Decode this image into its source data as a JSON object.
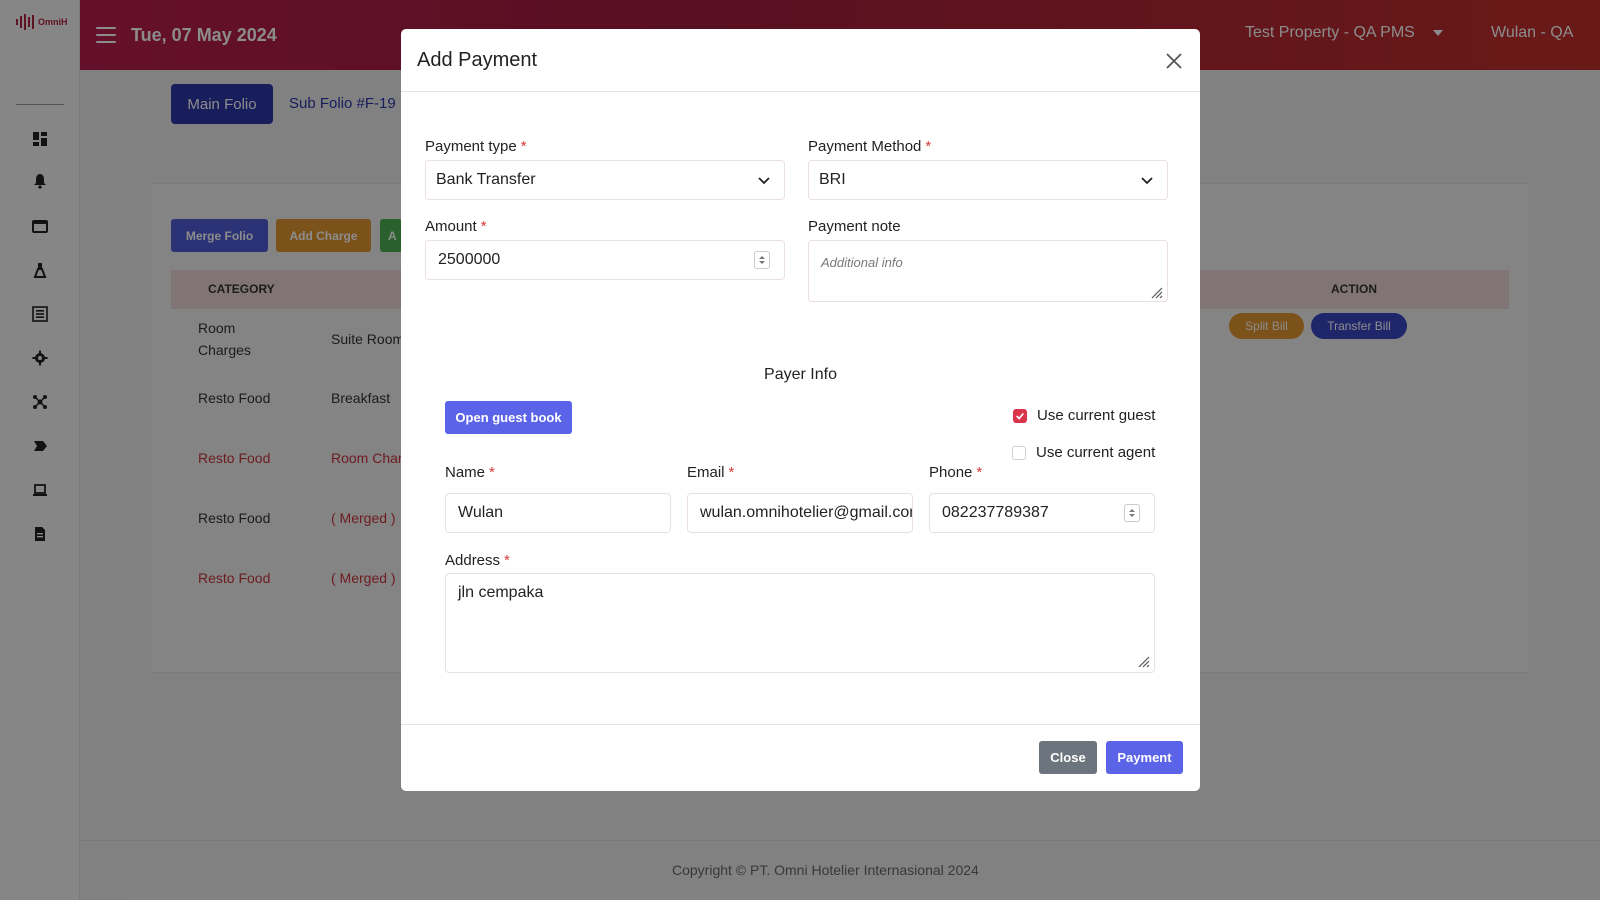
{
  "sidebar": {
    "logo_text": "OmniH",
    "icons": [
      "dashboard-icon",
      "bell-icon",
      "folder-icon",
      "flask-icon",
      "list-icon",
      "gear-icon",
      "network-icon",
      "tag-icon",
      "laptop-icon",
      "document-icon"
    ]
  },
  "header": {
    "date": "Tue, 07 May 2024",
    "property": "Test Property - QA PMS",
    "user": "Wulan - QA"
  },
  "folio": {
    "main_label": "Main Folio",
    "sub_label": "Sub Folio #F-19"
  },
  "actions": {
    "merge": "Merge Folio",
    "add_charge": "Add Charge",
    "third": "A"
  },
  "table": {
    "headers": {
      "category": "CATEGORY",
      "action": "ACTION"
    },
    "rows": [
      {
        "category": "Room\nCharges",
        "item": "Suite Room",
        "red": false
      },
      {
        "category": "Resto Food",
        "item": "Breakfast",
        "red": false
      },
      {
        "category": "Resto Food",
        "item": "Room Char",
        "red": true
      },
      {
        "category": "Resto Food",
        "item": "( Merged )",
        "red": false
      },
      {
        "category": "Resto Food",
        "item": "( Merged )",
        "red": true
      }
    ],
    "split_bill": "Split Bill",
    "transfer_bill": "Transfer Bill"
  },
  "footer": {
    "copyright": "Copyright © PT. Omni Hotelier Internasional 2024"
  },
  "modal": {
    "title": "Add Payment",
    "payment_type_label": "Payment type",
    "payment_type_value": "Bank Transfer",
    "payment_method_label": "Payment Method",
    "payment_method_value": "BRI",
    "amount_label": "Amount",
    "amount_value": "2500000",
    "note_label": "Payment note",
    "note_placeholder": "Additional info",
    "payer_info_title": "Payer Info",
    "open_guest_book": "Open guest book",
    "use_current_guest": "Use current guest",
    "use_current_guest_checked": true,
    "use_current_agent": "Use current agent",
    "use_current_agent_checked": false,
    "name_label": "Name",
    "name_value": "Wulan",
    "email_label": "Email",
    "email_value": "wulan.omnihotelier@gmail.com",
    "phone_label": "Phone",
    "phone_value": "082237789387",
    "address_label": "Address",
    "address_value": "jln cempaka",
    "close_button": "Close",
    "payment_button": "Payment"
  },
  "colors": {
    "header_start": "#b81e4d",
    "header_end": "#c0302b",
    "primary": "#5b63e8",
    "folio_blue": "#2c36a8",
    "danger": "#d8354a",
    "secondary": "#6c757d",
    "warning": "#e0962e",
    "success": "#4caf50"
  }
}
